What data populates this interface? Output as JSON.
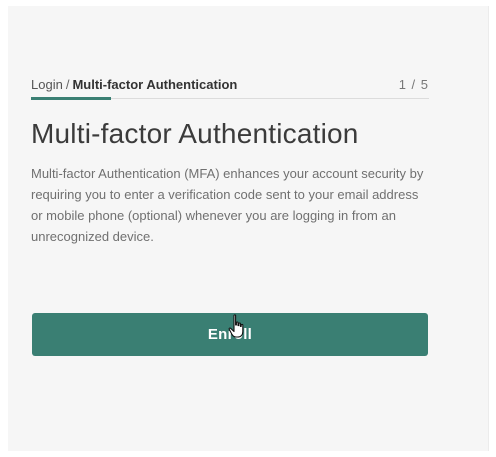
{
  "breadcrumb": {
    "root": "Login",
    "separator": "/",
    "current": "Multi-factor Authentication",
    "step": "1 / 5"
  },
  "page_title": "Multi-factor Authentication",
  "description": "Multi-factor Authentication (MFA) enhances your account security by requiring you to enter a verification code sent to your email address or mobile phone (optional) whenever you are logging in from an unrecognized device.",
  "enroll_button": {
    "label": "Enroll"
  },
  "progress": {
    "fraction": 0.2
  },
  "colors": {
    "accent": "#3a7f73",
    "card_background": "#f6f6f6"
  },
  "icons": {
    "cursor": "hand-pointer-icon"
  }
}
